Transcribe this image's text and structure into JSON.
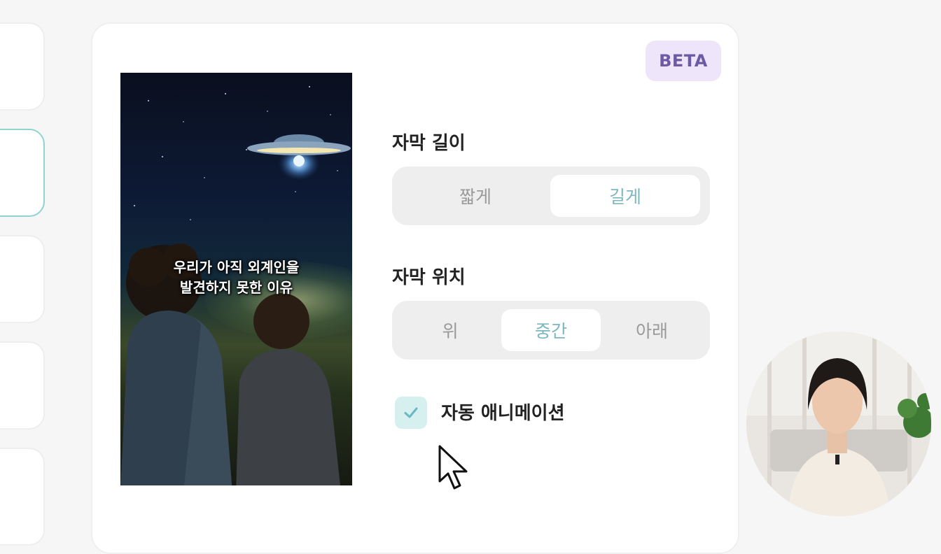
{
  "badge": {
    "label": "BETA"
  },
  "preview": {
    "caption_line1": "우리가 아직 외계인을",
    "caption_line2": "발견하지 못한 이유"
  },
  "subtitle_length": {
    "label": "자막 길이",
    "options": [
      "짧게",
      "길게"
    ],
    "selected": "길게"
  },
  "subtitle_position": {
    "label": "자막 위치",
    "options": [
      "위",
      "중간",
      "아래"
    ],
    "selected": "중간"
  },
  "auto_animation": {
    "label": "자동 애니메이션",
    "checked": true
  },
  "colors": {
    "accent": "#7cb6bf",
    "check_bg": "#d6f0f0",
    "badge_bg": "#efe5fb",
    "badge_text": "#6d5aa5",
    "active_card_border": "#8fd3d0"
  },
  "icons": [
    "checkmark-icon",
    "mouse-cursor-icon",
    "ufo-illustration"
  ]
}
